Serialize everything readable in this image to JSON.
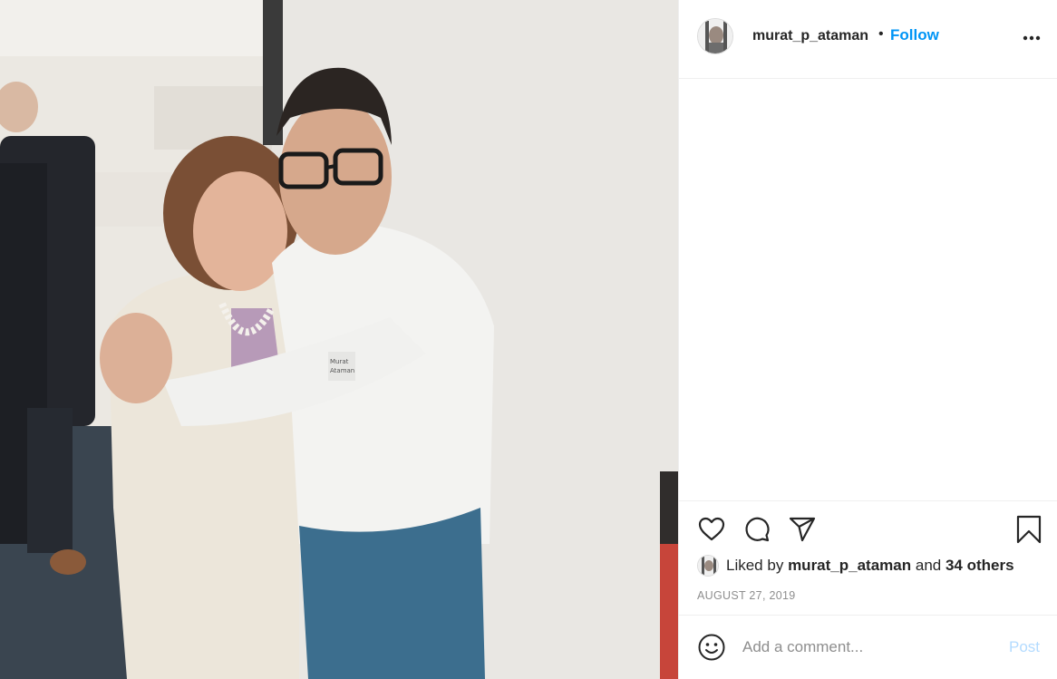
{
  "post": {
    "username": "murat_p_ataman",
    "separator": "•",
    "follow_label": "Follow",
    "more_icon": "more-horizontal-icon"
  },
  "photo": {
    "badge_text_line1": "Murat",
    "badge_text_line2": "Ataman"
  },
  "actions": {
    "like_icon": "heart-icon",
    "comment_icon": "comment-icon",
    "share_icon": "paper-plane-icon",
    "save_icon": "bookmark-icon"
  },
  "likes": {
    "prefix": "Liked by",
    "user": "murat_p_ataman",
    "and": "and",
    "others": "34 others"
  },
  "date": "AUGUST 27, 2019",
  "comment": {
    "placeholder": "Add a comment...",
    "post_label": "Post",
    "emoji_icon": "smiley-icon"
  },
  "colors": {
    "accent": "#0095f6",
    "post_disabled": "#b3dbff",
    "text": "#262626",
    "muted": "#8e8e8e",
    "border": "#efefef"
  }
}
